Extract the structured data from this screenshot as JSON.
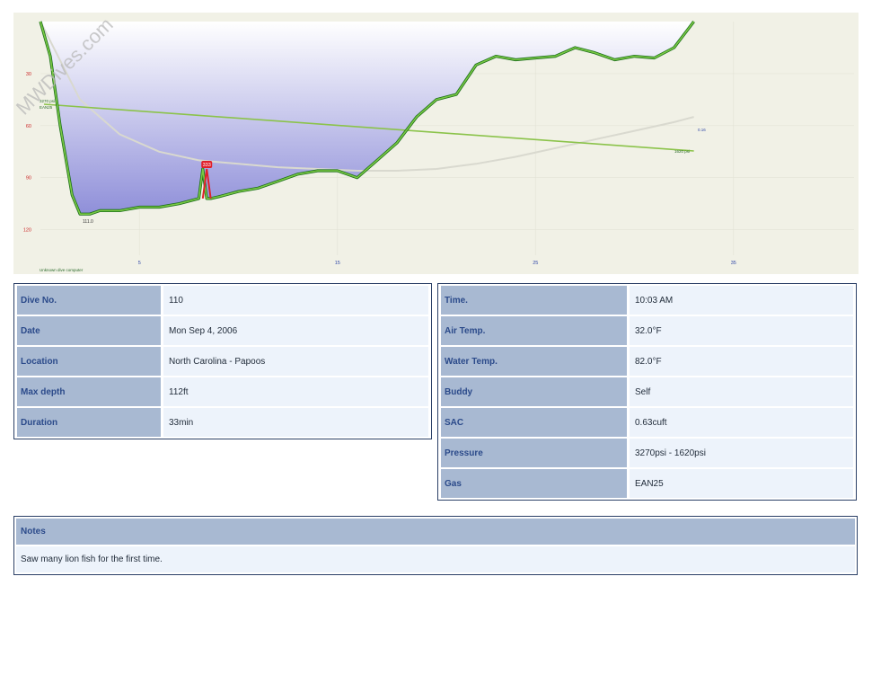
{
  "watermark": "MWDives.com",
  "profile": {
    "computer": "Unknown dive computer",
    "x_ticks": [
      "5",
      "15",
      "25",
      "35"
    ],
    "y_ticks": [
      "30",
      "60",
      "90",
      "120"
    ],
    "max_depth_label": "111.0",
    "start_pressure": "3270 psi",
    "end_pressure": "1620 psi",
    "gas_label": "EAN25",
    "ascent_marker": "333",
    "tissue_label": "0.16"
  },
  "chart_data": {
    "type": "line",
    "x_range_min": [
      0,
      40
    ],
    "depth_range_ft": [
      0,
      140
    ],
    "depth_profile": {
      "time_min": [
        0,
        0.5,
        1,
        1.6,
        2,
        2.5,
        3,
        4,
        5,
        6,
        7,
        8,
        8.2,
        8.4,
        8.6,
        9,
        10,
        11,
        12,
        13,
        14,
        15,
        16,
        17,
        18,
        19,
        20,
        21,
        22,
        23,
        24,
        25,
        26,
        27,
        28,
        29,
        30,
        31,
        32,
        33
      ],
      "depth_ft": [
        0,
        20,
        60,
        100,
        111,
        111,
        109,
        109,
        107,
        107,
        105,
        102,
        85,
        102,
        102,
        101,
        98,
        96,
        92,
        88,
        86,
        86,
        90,
        80,
        70,
        55,
        45,
        42,
        25,
        20,
        22,
        21,
        20,
        15,
        18,
        22,
        20,
        21,
        15,
        0
      ]
    },
    "pressure_psi": {
      "time_min": [
        0,
        33
      ],
      "values": [
        3270,
        1620
      ]
    },
    "tissue_curve": {
      "time_min": [
        0,
        2,
        4,
        6,
        8,
        10,
        12,
        14,
        16,
        18,
        20,
        22,
        24,
        26,
        28,
        30,
        32,
        33
      ],
      "depth_ft": [
        0,
        45,
        65,
        75,
        80,
        82,
        84,
        85,
        86,
        86,
        85,
        82,
        78,
        73,
        68,
        63,
        58,
        55
      ]
    }
  },
  "info_left": [
    {
      "label": "Dive No.",
      "value": "110"
    },
    {
      "label": "Date",
      "value": "Mon Sep 4, 2006"
    },
    {
      "label": "Location",
      "value": "North Carolina - Papoos"
    },
    {
      "label": "Max depth",
      "value": "112ft"
    },
    {
      "label": "Duration",
      "value": "33min"
    }
  ],
  "info_right": [
    {
      "label": "Time.",
      "value": "10:03 AM"
    },
    {
      "label": "Air Temp.",
      "value": "32.0°F"
    },
    {
      "label": "Water Temp.",
      "value": "82.0°F"
    },
    {
      "label": "Buddy",
      "value": "Self"
    },
    {
      "label": "SAC",
      "value": "0.63cuft"
    },
    {
      "label": "Pressure",
      "value": "3270psi - 1620psi"
    },
    {
      "label": "Gas",
      "value": "EAN25"
    }
  ],
  "notes": {
    "title": "Notes",
    "text": "Saw  many lion fish for the first time."
  },
  "colors": {
    "chart_bg": "#f1f1e6",
    "water_top": "#ffffff",
    "water_bottom": "#8f8fd9",
    "profile_green": "#7ac943",
    "profile_dark": "#1b6e1b",
    "pressure_line": "#8bc34a",
    "tissue_line": "#d9d9cf",
    "ascent_red": "#e0202a",
    "tick_red": "#cc2a2a",
    "tick_blue": "#3048a8"
  }
}
